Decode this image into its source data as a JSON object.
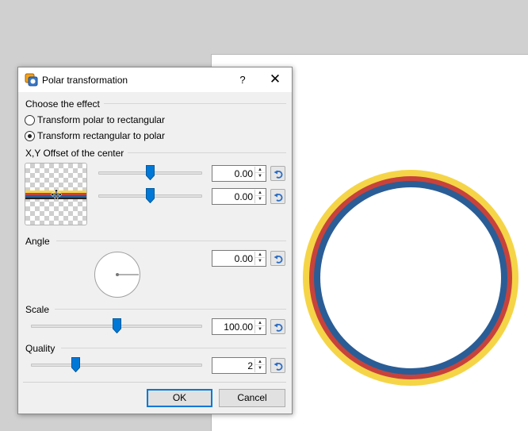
{
  "dialog": {
    "title": "Polar transformation",
    "help_label": "?",
    "close_label": "✕"
  },
  "effect": {
    "group_label": "Choose the effect",
    "options": [
      {
        "label": "Transform polar to rectangular",
        "checked": false
      },
      {
        "label": "Transform rectangular to polar",
        "checked": true
      }
    ]
  },
  "offset": {
    "group_label": "X,Y Offset of the center",
    "x_value": "0.00",
    "y_value": "0.00",
    "x_slider_fraction": 0.5,
    "y_slider_fraction": 0.5
  },
  "angle": {
    "group_label": "Angle",
    "value": "0.00"
  },
  "scale": {
    "group_label": "Scale",
    "value": "100.00",
    "slider_fraction": 0.5
  },
  "quality": {
    "group_label": "Quality",
    "value": "2",
    "slider_fraction": 0.25
  },
  "buttons": {
    "ok_label": "OK",
    "cancel_label": "Cancel"
  },
  "colors": {
    "accent": "#0078d7",
    "ring_yellow": "#f5d547",
    "ring_red": "#c8423b",
    "ring_blue": "#2a5d96"
  },
  "icons": {
    "title": "app-icon",
    "reset": "reset-icon",
    "crosshair": "move-crosshair-icon"
  }
}
